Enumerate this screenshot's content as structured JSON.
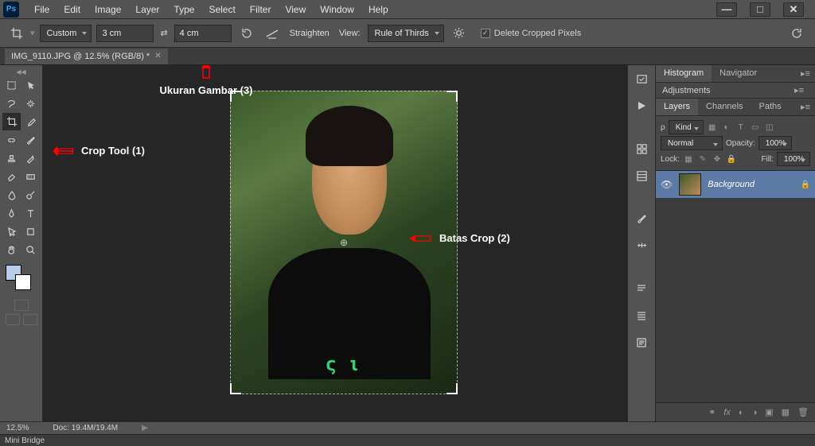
{
  "app": {
    "logo": "Ps"
  },
  "menu": [
    "File",
    "Edit",
    "Image",
    "Layer",
    "Type",
    "Select",
    "Filter",
    "View",
    "Window",
    "Help"
  ],
  "options": {
    "preset": "Custom",
    "width": "3 cm",
    "height": "4 cm",
    "straighten": "Straighten",
    "view_label": "View:",
    "overlay": "Rule of Thirds",
    "delete_cropped": "Delete Cropped Pixels",
    "delete_checked": "✓"
  },
  "document": {
    "tab_title": "IMG_9110.JPG @ 12.5% (RGB/8) *"
  },
  "annotations": {
    "crop_tool": "Crop Tool  (1)",
    "batas_crop": "Batas Crop  (2)",
    "ukuran": "Ukuran Gambar  (3)"
  },
  "panels": {
    "histogram": "Histogram",
    "navigator": "Navigator",
    "adjustments": "Adjustments",
    "layers": "Layers",
    "channels": "Channels",
    "paths": "Paths"
  },
  "layers_panel": {
    "filter_kind": "Kind",
    "blend_mode": "Normal",
    "opacity_label": "Opacity:",
    "opacity_value": "100%",
    "lock_label": "Lock:",
    "fill_label": "Fill:",
    "fill_value": "100%",
    "layer0": "Background"
  },
  "status": {
    "zoom": "12.5%",
    "doc_info": "Doc: 19.4M/19.4M"
  },
  "mini_bridge": "Mini Bridge",
  "tshirt_print": "ς ι"
}
